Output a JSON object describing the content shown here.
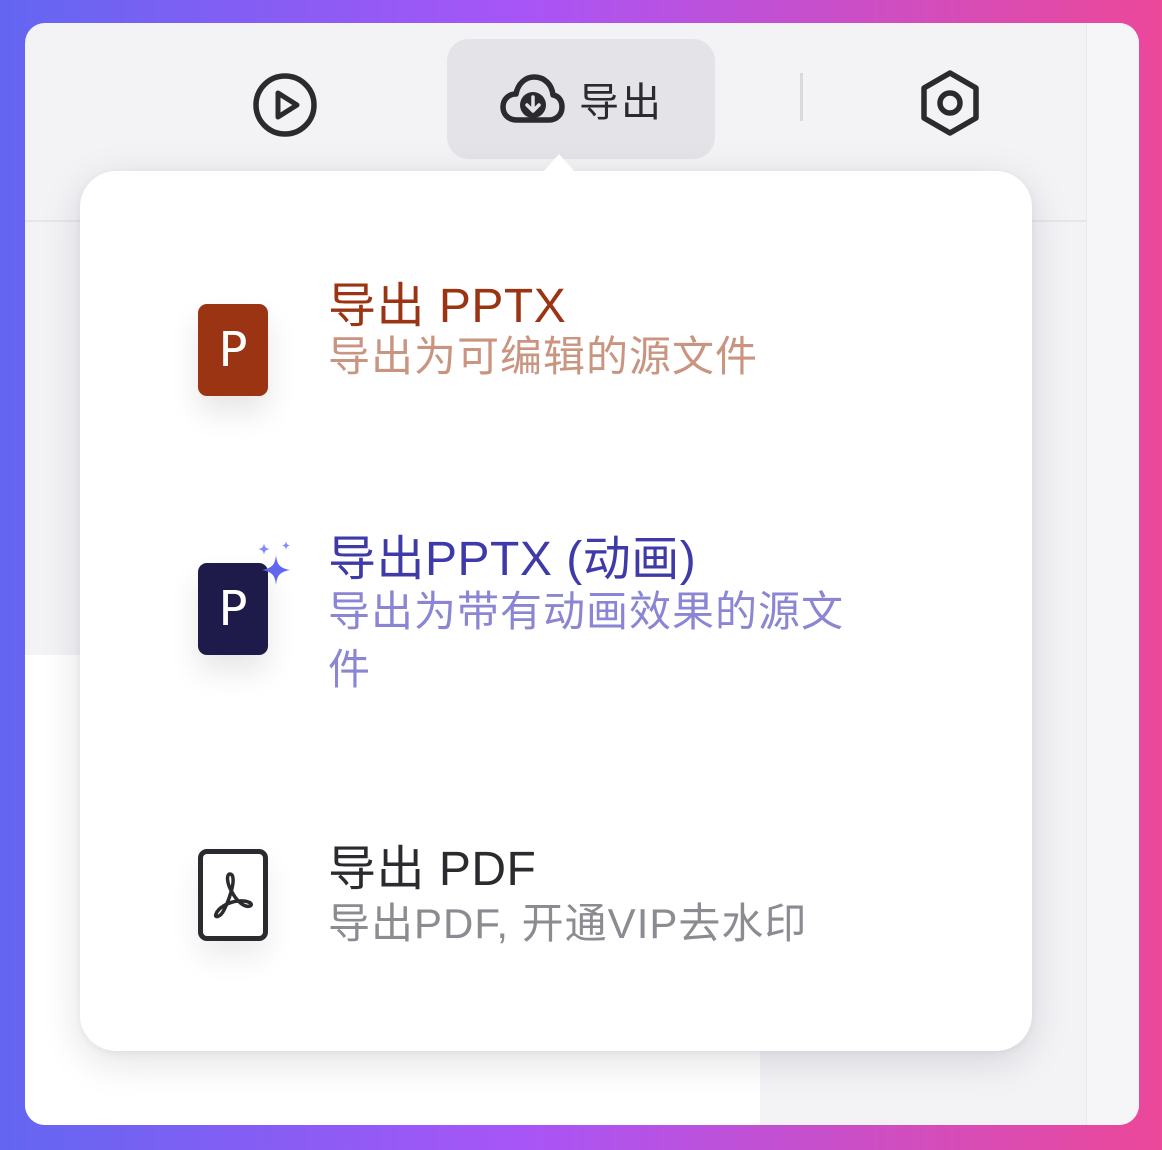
{
  "toolbar": {
    "play_icon": "play-circle-icon",
    "export_label": "导出",
    "export_icon": "cloud-download-icon",
    "settings_icon": "hexagon-settings-icon"
  },
  "export_menu": {
    "items": [
      {
        "title": "导出 PPTX",
        "description": "导出为可编辑的源文件",
        "icon": "pptx-file-icon",
        "icon_letter": "P",
        "color": "#9a3412"
      },
      {
        "title": "导出PPTX (动画)",
        "description": "导出为带有动画效果的源文件",
        "icon": "pptx-animated-file-icon",
        "icon_letter": "P",
        "color": "#3e3aa8"
      },
      {
        "title": "导出 PDF",
        "description": "导出PDF, 开通VIP去水印",
        "icon": "pdf-file-icon",
        "color": "#2b2b2f"
      }
    ]
  }
}
